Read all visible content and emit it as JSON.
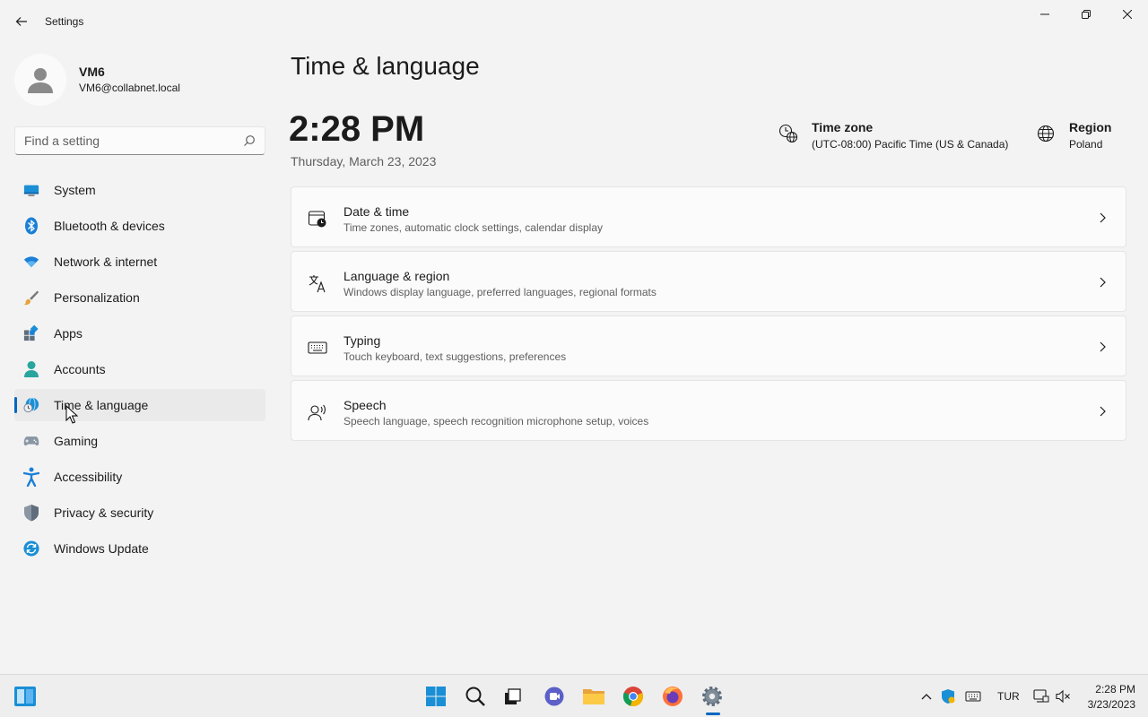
{
  "window": {
    "title": "Settings"
  },
  "user": {
    "name": "VM6",
    "email": "VM6@collabnet.local"
  },
  "search": {
    "placeholder": "Find a setting"
  },
  "nav": {
    "items": [
      {
        "label": "System",
        "icon": "monitor-icon"
      },
      {
        "label": "Bluetooth & devices",
        "icon": "bluetooth-icon"
      },
      {
        "label": "Network & internet",
        "icon": "wifi-icon"
      },
      {
        "label": "Personalization",
        "icon": "brush-icon"
      },
      {
        "label": "Apps",
        "icon": "apps-icon"
      },
      {
        "label": "Accounts",
        "icon": "person-icon"
      },
      {
        "label": "Time & language",
        "icon": "globe-clock-icon",
        "selected": true
      },
      {
        "label": "Gaming",
        "icon": "gamepad-icon"
      },
      {
        "label": "Accessibility",
        "icon": "accessibility-icon"
      },
      {
        "label": "Privacy & security",
        "icon": "shield-icon"
      },
      {
        "label": "Windows Update",
        "icon": "update-icon"
      }
    ]
  },
  "main": {
    "title": "Time & language",
    "time": "2:28 PM",
    "date": "Thursday, March 23, 2023",
    "timezone": {
      "title": "Time zone",
      "value": "(UTC-08:00) Pacific Time (US & Canada)"
    },
    "region": {
      "title": "Region",
      "value": "Poland"
    },
    "cards": [
      {
        "title": "Date & time",
        "desc": "Time zones, automatic clock settings, calendar display",
        "icon": "calendar-clock-icon"
      },
      {
        "title": "Language & region",
        "desc": "Windows display language, preferred languages, regional formats",
        "icon": "language-icon"
      },
      {
        "title": "Typing",
        "desc": "Touch keyboard, text suggestions, preferences",
        "icon": "keyboard-icon"
      },
      {
        "title": "Speech",
        "desc": "Speech language, speech recognition microphone setup, voices",
        "icon": "speech-icon"
      }
    ]
  },
  "taskbar": {
    "lang": "TUR",
    "clock_time": "2:28 PM",
    "clock_date": "3/23/2023"
  },
  "colors": {
    "accent": "#0067c0",
    "background": "#f3f3f3",
    "card": "#fbfbfb"
  }
}
